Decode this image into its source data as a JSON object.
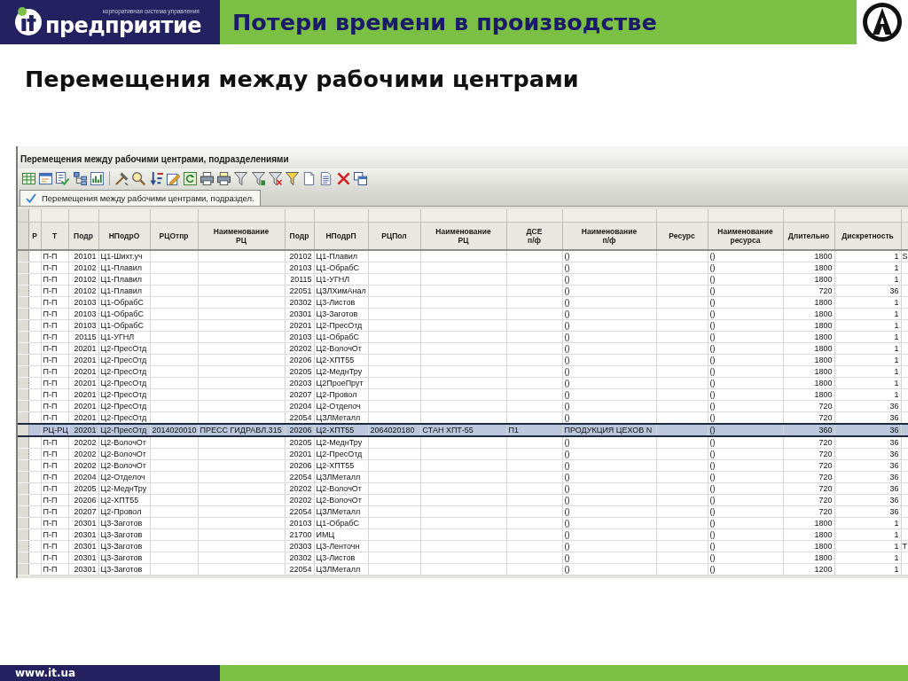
{
  "header": {
    "logo": {
      "tagline": "корпоративная система управления",
      "wordmark": "предприятие"
    },
    "title": "Потери времени в производстве"
  },
  "subtitle": "Перемещения между рабочими центрами",
  "app_window": {
    "title": "Перемещения между рабочими центрами, подразделениями",
    "tabs": [
      {
        "label": "Перемещения между рабочими центрами, подраздел.",
        "selected": true
      }
    ],
    "table": {
      "columns": [
        "Р",
        "Т",
        "Подр",
        "НПодрО",
        "РЦОтпр",
        "Наименование РЦ",
        "Подр",
        "НПодрП",
        "РЦПол",
        "Наименование РЦ",
        "ДСЕ п/ф",
        "Наименование п/ф",
        "Ресурс",
        "Наименование ресурса",
        "Длительно",
        "Дискретность"
      ],
      "rows": [
        {
          "selected": false,
          "type": "П-П",
          "sender_dept": "20101",
          "sender_dept_name": "Ц1-Шихт.уч",
          "receiver_dept": "20102",
          "receiver_dept_name": "Ц1-Плавил",
          "part_name": "()",
          "resource_name": "()",
          "duration": "1800",
          "discreteness": "1",
          "column_17": "S"
        },
        {
          "selected": false,
          "type": "П-П",
          "sender_dept": "20102",
          "sender_dept_name": "Ц1-Плавил",
          "receiver_dept": "20103",
          "receiver_dept_name": "Ц1-ОбрабС",
          "part_name": "()",
          "resource_name": "()",
          "duration": "1800",
          "discreteness": "1"
        },
        {
          "selected": false,
          "type": "П-П",
          "sender_dept": "20102",
          "sender_dept_name": "Ц1-Плавил",
          "receiver_dept": "20115",
          "receiver_dept_name": "Ц1-УГНЛ",
          "part_name": "()",
          "resource_name": "()",
          "duration": "1800",
          "discreteness": "1"
        },
        {
          "selected": false,
          "type": "П-П",
          "sender_dept": "20102",
          "sender_dept_name": "Ц1-Плавил",
          "receiver_dept": "22051",
          "receiver_dept_name": "ЦЗЛХимАнал",
          "part_name": "()",
          "resource_name": "()",
          "duration": "720",
          "discreteness": "36"
        },
        {
          "selected": false,
          "type": "П-П",
          "sender_dept": "20103",
          "sender_dept_name": "Ц1-ОбрабС",
          "receiver_dept": "20302",
          "receiver_dept_name": "Ц3-Листов",
          "part_name": "()",
          "resource_name": "()",
          "duration": "1800",
          "discreteness": "1"
        },
        {
          "selected": false,
          "type": "П-П",
          "sender_dept": "20103",
          "sender_dept_name": "Ц1-ОбрабС",
          "receiver_dept": "20301",
          "receiver_dept_name": "Ц3-Заготов",
          "part_name": "()",
          "resource_name": "()",
          "duration": "1800",
          "discreteness": "1"
        },
        {
          "selected": false,
          "type": "П-П",
          "sender_dept": "20103",
          "sender_dept_name": "Ц1-ОбрабС",
          "receiver_dept": "20201",
          "receiver_dept_name": "Ц2-ПресОтд",
          "part_name": "()",
          "resource_name": "()",
          "duration": "1800",
          "discreteness": "1"
        },
        {
          "selected": false,
          "type": "П-П",
          "sender_dept": "20115",
          "sender_dept_name": "Ц1-УГНЛ",
          "receiver_dept": "20103",
          "receiver_dept_name": "Ц1-ОбрабС",
          "part_name": "()",
          "resource_name": "()",
          "duration": "1800",
          "discreteness": "1"
        },
        {
          "selected": false,
          "type": "П-П",
          "sender_dept": "20201",
          "sender_dept_name": "Ц2-ПресОтд",
          "receiver_dept": "20202",
          "receiver_dept_name": "Ц2-ВолочОт",
          "part_name": "()",
          "resource_name": "()",
          "duration": "1800",
          "discreteness": "1"
        },
        {
          "selected": false,
          "type": "П-П",
          "sender_dept": "20201",
          "sender_dept_name": "Ц2-ПресОтд",
          "receiver_dept": "20206",
          "receiver_dept_name": "Ц2-ХПТ55",
          "part_name": "()",
          "resource_name": "()",
          "duration": "1800",
          "discreteness": "1"
        },
        {
          "selected": false,
          "type": "П-П",
          "sender_dept": "20201",
          "sender_dept_name": "Ц2-ПресОтд",
          "receiver_dept": "20205",
          "receiver_dept_name": "Ц2-МеднТру",
          "part_name": "()",
          "resource_name": "()",
          "duration": "1800",
          "discreteness": "1"
        },
        {
          "selected": false,
          "type": "П-П",
          "sender_dept": "20201",
          "sender_dept_name": "Ц2-ПресОтд",
          "receiver_dept": "20203",
          "receiver_dept_name": "Ц2ПроеПрут",
          "part_name": "()",
          "resource_name": "()",
          "duration": "1800",
          "discreteness": "1"
        },
        {
          "selected": false,
          "type": "П-П",
          "sender_dept": "20201",
          "sender_dept_name": "Ц2-ПресОтд",
          "receiver_dept": "20207",
          "receiver_dept_name": "Ц2-Провол",
          "part_name": "()",
          "resource_name": "()",
          "duration": "1800",
          "discreteness": "1"
        },
        {
          "selected": false,
          "type": "П-П",
          "sender_dept": "20201",
          "sender_dept_name": "Ц2-ПресОтд",
          "receiver_dept": "20204",
          "receiver_dept_name": "Ц2-Отделоч",
          "part_name": "()",
          "resource_name": "()",
          "duration": "720",
          "discreteness": "36"
        },
        {
          "selected": false,
          "type": "П-П",
          "sender_dept": "20201",
          "sender_dept_name": "Ц2-ПресОтд",
          "receiver_dept": "22054",
          "receiver_dept_name": "ЦЗЛМеталл",
          "part_name": "()",
          "resource_name": "()",
          "duration": "720",
          "discreteness": "36"
        },
        {
          "selected": true,
          "type": "РЦ-РЦ",
          "sender_dept": "20201",
          "sender_dept_name": "Ц2-ПресОтд",
          "sender_wc": "2014020010",
          "sender_wc_name": "ПРЕСС ГИДРАВЛ.315",
          "receiver_dept": "20206",
          "receiver_dept_name": "Ц2-ХПТ55",
          "receiver_wc": "2064020180",
          "receiver_wc_name": "СТАН ХПТ-55",
          "part": "П1",
          "part_name": "ПРОДУКЦИЯ ЦЕХОВ N",
          "resource_name": "()",
          "duration": "360",
          "discreteness": "36"
        },
        {
          "selected": false,
          "type": "П-П",
          "sender_dept": "20202",
          "sender_dept_name": "Ц2-ВолочОт",
          "receiver_dept": "20205",
          "receiver_dept_name": "Ц2-МеднТру",
          "part_name": "()",
          "resource_name": "()",
          "duration": "720",
          "discreteness": "36"
        },
        {
          "selected": false,
          "type": "П-П",
          "sender_dept": "20202",
          "sender_dept_name": "Ц2-ВолочОт",
          "receiver_dept": "20201",
          "receiver_dept_name": "Ц2-ПресОтд",
          "part_name": "()",
          "resource_name": "()",
          "duration": "720",
          "discreteness": "36"
        },
        {
          "selected": false,
          "type": "П-П",
          "sender_dept": "20202",
          "sender_dept_name": "Ц2-ВолочОт",
          "receiver_dept": "20206",
          "receiver_dept_name": "Ц2-ХПТ55",
          "part_name": "()",
          "resource_name": "()",
          "duration": "720",
          "discreteness": "36"
        },
        {
          "selected": false,
          "type": "П-П",
          "sender_dept": "20204",
          "sender_dept_name": "Ц2-Отделоч",
          "receiver_dept": "22054",
          "receiver_dept_name": "ЦЗЛМеталл",
          "part_name": "()",
          "resource_name": "()",
          "duration": "720",
          "discreteness": "36"
        },
        {
          "selected": false,
          "type": "П-П",
          "sender_dept": "20205",
          "sender_dept_name": "Ц2-МеднТру",
          "receiver_dept": "20202",
          "receiver_dept_name": "Ц2-ВолочОт",
          "part_name": "()",
          "resource_name": "()",
          "duration": "720",
          "discreteness": "36"
        },
        {
          "selected": false,
          "type": "П-П",
          "sender_dept": "20206",
          "sender_dept_name": "Ц2-ХПТ55",
          "receiver_dept": "20202",
          "receiver_dept_name": "Ц2-ВолочОт",
          "part_name": "()",
          "resource_name": "()",
          "duration": "720",
          "discreteness": "36"
        },
        {
          "selected": false,
          "type": "П-П",
          "sender_dept": "20207",
          "sender_dept_name": "Ц2-Провол",
          "receiver_dept": "22054",
          "receiver_dept_name": "ЦЗЛМеталл",
          "part_name": "()",
          "resource_name": "()",
          "duration": "720",
          "discreteness": "36"
        },
        {
          "selected": false,
          "type": "П-П",
          "sender_dept": "20301",
          "sender_dept_name": "Ц3-Заготов",
          "receiver_dept": "20103",
          "receiver_dept_name": "Ц1-ОбрабС",
          "part_name": "()",
          "resource_name": "()",
          "duration": "1800",
          "discreteness": "1"
        },
        {
          "selected": false,
          "type": "П-П",
          "sender_dept": "20301",
          "sender_dept_name": "Ц3-Заготов",
          "receiver_dept": "21700",
          "receiver_dept_name": "ИМЦ",
          "part_name": "()",
          "resource_name": "()",
          "duration": "1800",
          "discreteness": "1"
        },
        {
          "selected": false,
          "type": "П-П",
          "sender_dept": "20301",
          "sender_dept_name": "Ц3-Заготов",
          "receiver_dept": "20303",
          "receiver_dept_name": "Ц3-Ленточн",
          "part_name": "()",
          "resource_name": "()",
          "duration": "1800",
          "discreteness": "1",
          "column_17": "T"
        },
        {
          "selected": false,
          "type": "П-П",
          "sender_dept": "20301",
          "sender_dept_name": "Ц3-Заготов",
          "receiver_dept": "20302",
          "receiver_dept_name": "Ц3-Листов",
          "part_name": "()",
          "resource_name": "()",
          "duration": "1800",
          "discreteness": "1"
        },
        {
          "selected": false,
          "type": "П-П",
          "sender_dept": "20301",
          "sender_dept_name": "Ц3-Заготов",
          "receiver_dept": "22054",
          "receiver_dept_name": "ЦЗЛМеталл",
          "part_name": "()",
          "resource_name": "()",
          "duration": "1200",
          "discreteness": "1"
        }
      ]
    }
  },
  "footer": {
    "url": "www.it.ua"
  }
}
